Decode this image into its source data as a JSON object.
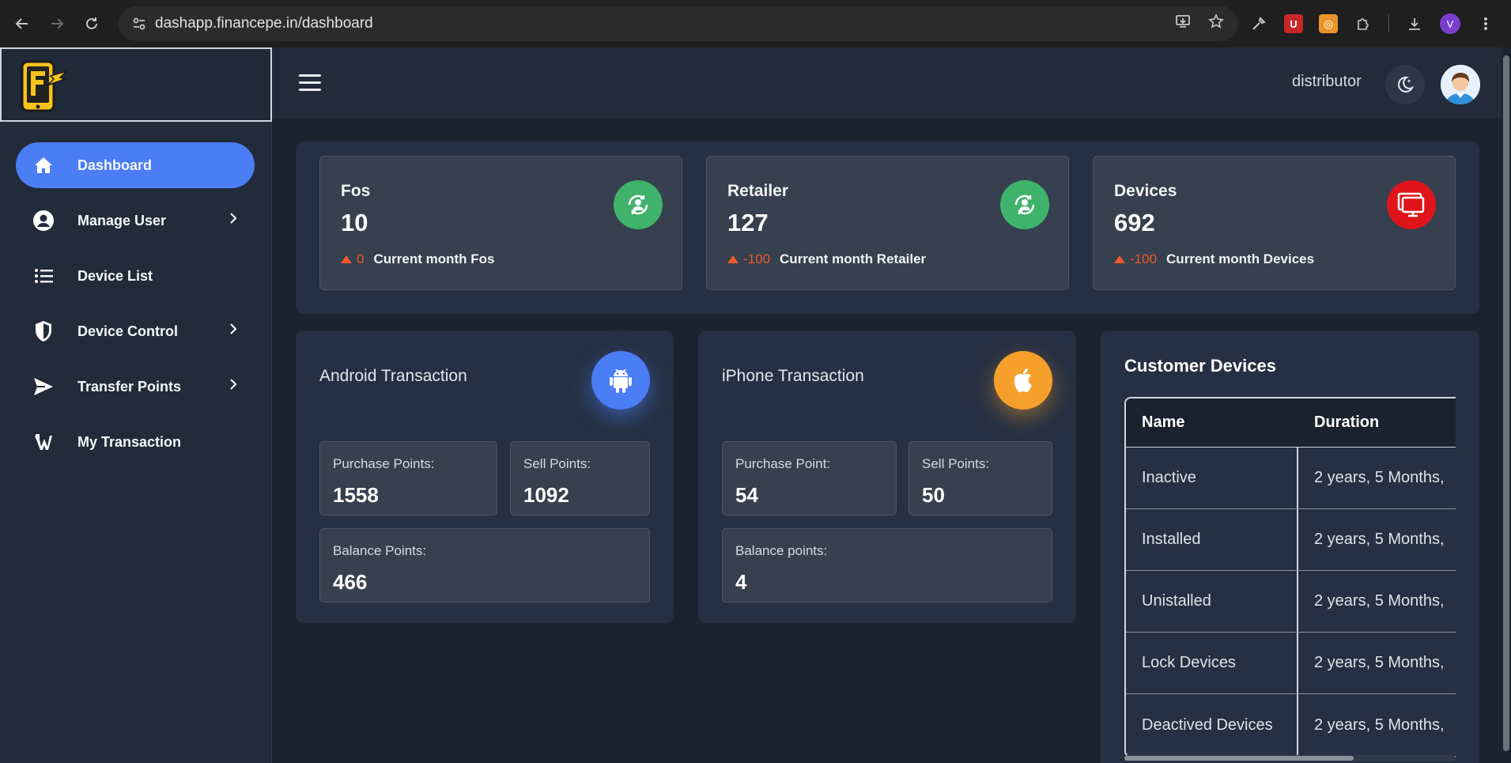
{
  "browser": {
    "url": "dashapp.financepe.in/dashboard",
    "profile_initial": "V"
  },
  "header": {
    "username": "distributor"
  },
  "sidebar": {
    "items": [
      {
        "label": "Dashboard",
        "icon": "home-icon",
        "active": true,
        "has_submenu": false
      },
      {
        "label": "Manage User",
        "icon": "user-circle-icon",
        "active": false,
        "has_submenu": true
      },
      {
        "label": "Device List",
        "icon": "list-icon",
        "active": false,
        "has_submenu": false
      },
      {
        "label": "Device Control",
        "icon": "shield-icon",
        "active": false,
        "has_submenu": true
      },
      {
        "label": "Transfer Points",
        "icon": "send-icon",
        "active": false,
        "has_submenu": true
      },
      {
        "label": "My Transaction",
        "icon": "wallet-icon",
        "active": false,
        "has_submenu": false
      }
    ]
  },
  "stats": [
    {
      "title": "Fos",
      "value": "10",
      "delta": "0",
      "delta_label": "Current month Fos",
      "icon": "user-sync-icon",
      "icon_color": "#3fb36b"
    },
    {
      "title": "Retailer",
      "value": "127",
      "delta": "-100",
      "delta_label": "Current month Retailer",
      "icon": "user-sync-icon",
      "icon_color": "#3fb36b"
    },
    {
      "title": "Devices",
      "value": "692",
      "delta": "-100",
      "delta_label": "Current month Devices",
      "icon": "monitor-icon",
      "icon_color": "#e0151b"
    }
  ],
  "android": {
    "title": "Android Transaction",
    "icon": "android-icon",
    "icon_color": "#4b7df5",
    "purchase_label": "Purchase Points:",
    "purchase_value": "1558",
    "sell_label": "Sell Points:",
    "sell_value": "1092",
    "balance_label": "Balance Points:",
    "balance_value": "466"
  },
  "iphone": {
    "title": "iPhone Transaction",
    "icon": "apple-icon",
    "icon_color": "#f6a02b",
    "purchase_label": "Purchase Point:",
    "purchase_value": "54",
    "sell_label": "Sell Points:",
    "sell_value": "50",
    "balance_label": "Balance points:",
    "balance_value": "4"
  },
  "customer_devices": {
    "title": "Customer Devices",
    "columns": [
      "Name",
      "Duration"
    ],
    "rows": [
      {
        "name": "Inactive",
        "duration": "2 years, 5 Months,"
      },
      {
        "name": "Installed",
        "duration": "2 years, 5 Months,"
      },
      {
        "name": "Unistalled",
        "duration": "2 years, 5 Months,"
      },
      {
        "name": "Lock Devices",
        "duration": "2 years, 5 Months,"
      },
      {
        "name": "Deactived Devices",
        "duration": "2 years, 5 Months,"
      }
    ]
  },
  "colors": {
    "accent": "#4b7df5",
    "negative": "#ee5a29",
    "panel": "#253042",
    "card": "#36404f"
  }
}
